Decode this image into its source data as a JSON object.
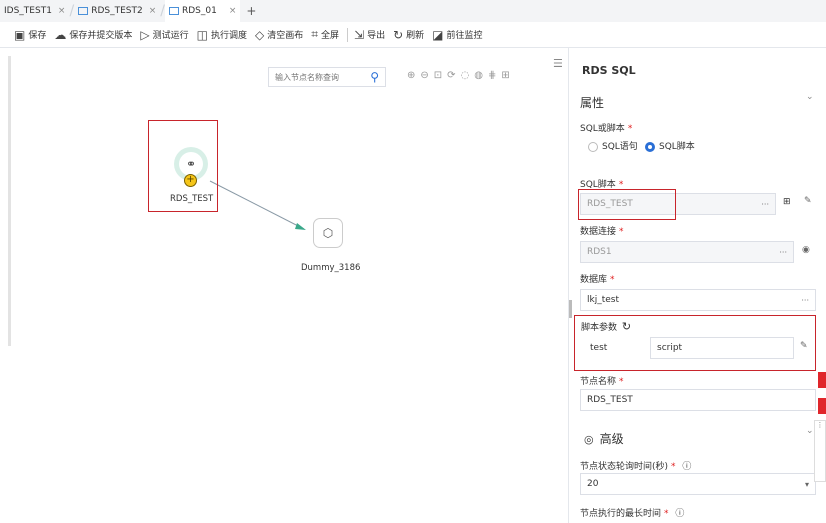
{
  "tabs": [
    {
      "label": "IDS_TEST1",
      "close": "×"
    },
    {
      "label": "RDS_TEST2",
      "close": "×"
    },
    {
      "label": "RDS_01",
      "close": "×"
    }
  ],
  "add_tab": "+",
  "toolbar": {
    "save": "保存",
    "save_submit": "保存并提交版本",
    "test_run": "测试运行",
    "schedule": "执行调度",
    "clear_canvas": "清空画布",
    "fullscreen": "全屏",
    "export": "导出",
    "refresh": "刷新",
    "monitor": "前往监控"
  },
  "canvas": {
    "search_placeholder": "输入节点名称查询",
    "nodes": {
      "rds": {
        "label": "RDS_TEST"
      },
      "dummy": {
        "label": "Dummy_3186"
      }
    }
  },
  "panel": {
    "title": "RDS SQL",
    "section_properties": "属性",
    "sql_or_script_label": "SQL或脚本",
    "radio_sql_statement": "SQL语句",
    "radio_sql_script": "SQL脚本",
    "sql_script_label": "SQL脚本",
    "sql_script_value": "RDS_TEST",
    "sql_script_more": "···",
    "datasource_label": "数据连接",
    "datasource_value": "RDS1",
    "datasource_more": "···",
    "database_label": "数据库",
    "database_value": "lkj_test",
    "database_more": "···",
    "script_params_label": "脚本参数",
    "param_name": "test",
    "param_value": "script",
    "node_name_label": "节点名称",
    "node_name_value": "RDS_TEST",
    "section_advanced": "高级",
    "poll_interval_label": "节点状态轮询时间(秒)",
    "poll_interval_value": "20",
    "max_exec_label": "节点执行的最长时间",
    "required_mark": "*"
  },
  "colors": {
    "accent": "#2a6fd6",
    "highlight": "#c8242b",
    "node_fill": "#d8efe7"
  }
}
